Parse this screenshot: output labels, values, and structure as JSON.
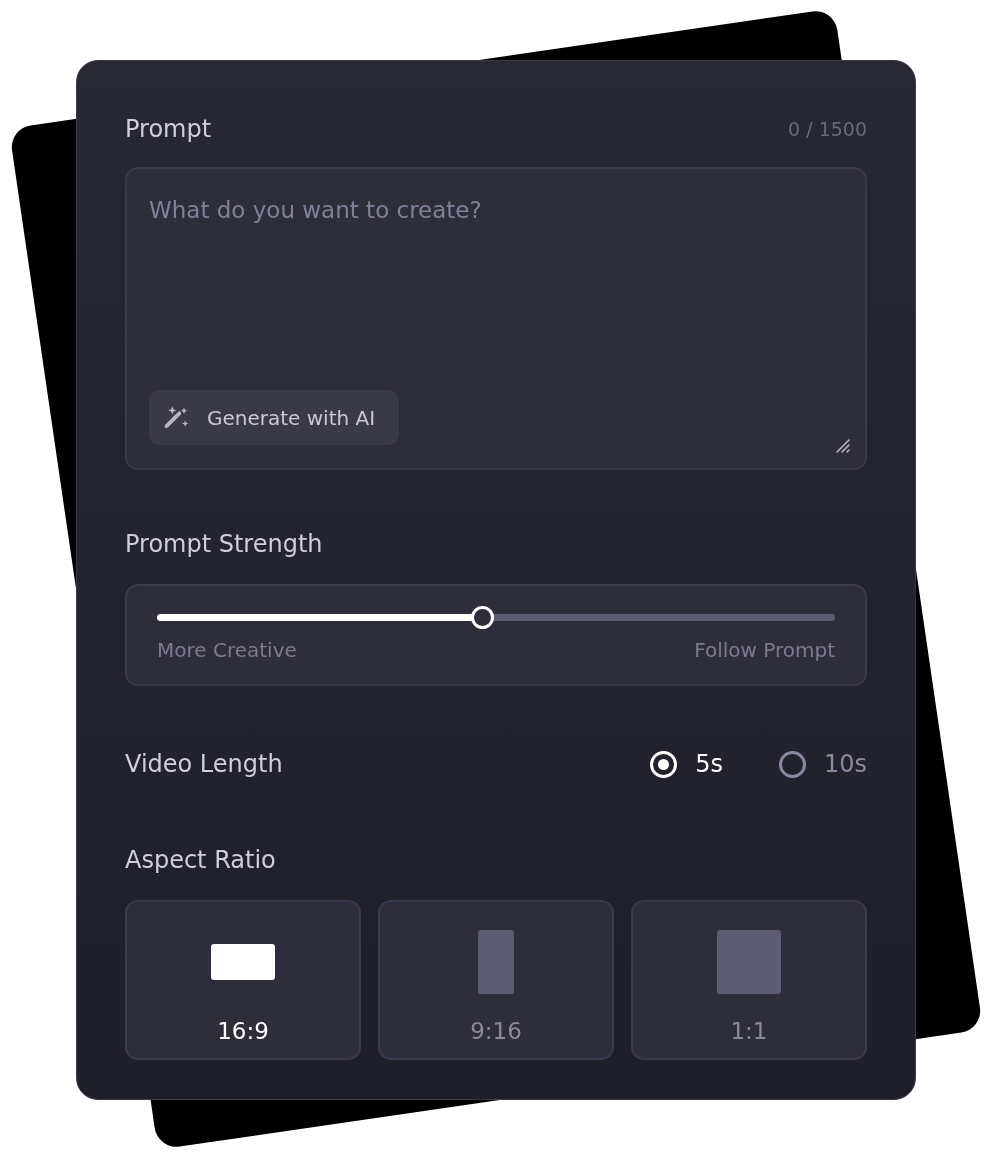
{
  "prompt": {
    "label": "Prompt",
    "counter": "0 / 1500",
    "placeholder": "What do you want to create?",
    "generate_button": "Generate with AI"
  },
  "prompt_strength": {
    "label": "Prompt Strength",
    "level": 0.48,
    "min_label": "More Creative",
    "max_label": "Follow Prompt"
  },
  "video_length": {
    "label": "Video Length",
    "options": [
      {
        "label": "5s",
        "selected": true
      },
      {
        "label": "10s",
        "selected": false
      }
    ]
  },
  "aspect_ratio": {
    "label": "Aspect Ratio",
    "options": [
      {
        "label": "16:9",
        "kind": "landscape",
        "selected": true
      },
      {
        "label": "9:16",
        "kind": "portrait",
        "selected": false
      },
      {
        "label": "1:1",
        "kind": "square",
        "selected": false
      }
    ]
  }
}
